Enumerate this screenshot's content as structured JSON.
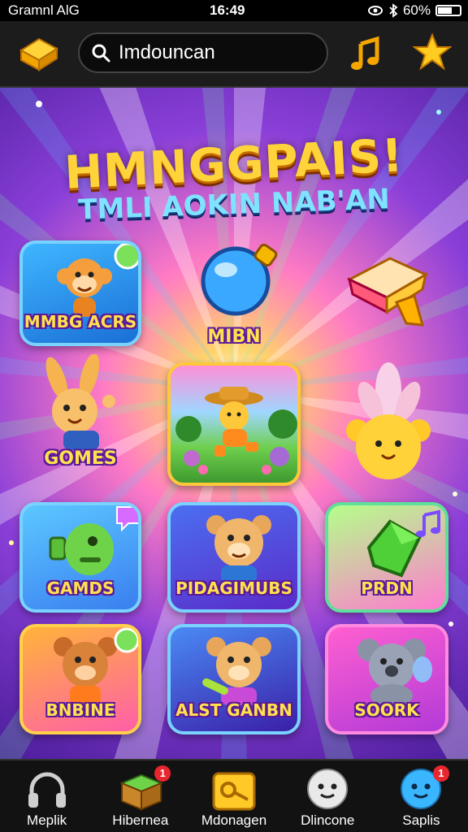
{
  "status_bar": {
    "carrier": "Gramnl AlG",
    "time": "16:49",
    "battery": "60%",
    "battery_level": 0.6
  },
  "top_bar": {
    "search_query": "Imdouncan",
    "icons": [
      "gold-block-icon",
      "search-icon",
      "music-note-icon",
      "star-icon"
    ]
  },
  "hero": {
    "title": "HMNGGPAIS!",
    "subtitle": "TMLI AOKIN NAB'AN"
  },
  "tiles": [
    {
      "label": "MMBG ACRS",
      "icon": "monkey-icon"
    },
    {
      "label": "MIBN",
      "icon": "blue-orb-icon"
    },
    {
      "label": "",
      "icon": "gift-box-icon"
    },
    {
      "label": "GOMES",
      "icon": "bunny-icon"
    },
    {
      "label": "",
      "icon": "adventure-scene-icon"
    },
    {
      "label": "",
      "icon": "golden-bear-icon"
    },
    {
      "label": "GAMDS",
      "icon": "green-robot-icon"
    },
    {
      "label": "PIDAGIMUBS",
      "icon": "bear-icon"
    },
    {
      "label": "PRDN",
      "icon": "green-gem-icon"
    },
    {
      "label": "BNBINE",
      "icon": "bear-icon"
    },
    {
      "label": "ALST GANBN",
      "icon": "bear-icon"
    },
    {
      "label": "SOORK",
      "icon": "koala-icon"
    }
  ],
  "bottom_nav": [
    {
      "label": "Meplik",
      "icon": "headphones-icon",
      "badge": ""
    },
    {
      "label": "Hibernea",
      "icon": "gift-box-icon",
      "badge": "1"
    },
    {
      "label": "Mdonagen",
      "icon": "key-box-icon",
      "badge": ""
    },
    {
      "label": "Dlincone",
      "icon": "smiley-face-icon",
      "badge": ""
    },
    {
      "label": "Saplis",
      "icon": "smiley-face-icon",
      "badge": "1"
    }
  ],
  "colors": {
    "accent_gold": "#ffd43a",
    "tile_border_blue": "#7ad2ff",
    "label_outline": "#5b1a9a",
    "badge_red": "#e8262d"
  }
}
